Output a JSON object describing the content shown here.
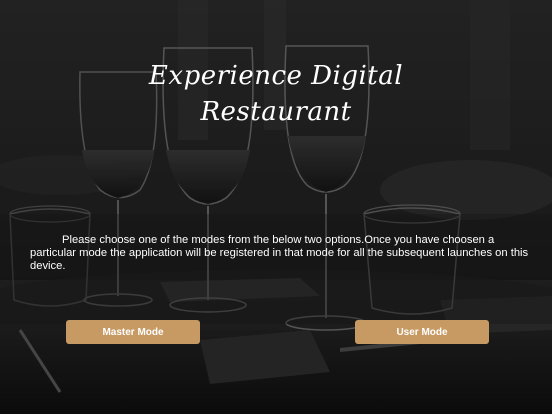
{
  "app": {
    "title_line1": "Experience Digital",
    "title_line2": "Restaurant"
  },
  "instructions": {
    "text": "Please choose one of the modes from the below two options.Once you have choosen a particular mode the application will be registered in that mode for all the subsequent launches on this device."
  },
  "buttons": {
    "master_label": "Master Mode",
    "user_label": "User Mode"
  },
  "colors": {
    "button_bg": "#c79a63",
    "text": "#ffffff"
  }
}
